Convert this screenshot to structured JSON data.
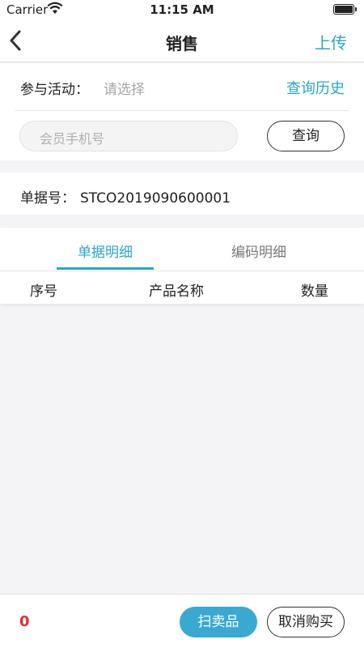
{
  "status_bar": {
    "carrier": "Carrier",
    "time": "11:15 AM"
  },
  "nav": {
    "title": "销售",
    "action": "上传"
  },
  "activity": {
    "label": "参与活动：",
    "value": "请选择",
    "history": "查询历史"
  },
  "member": {
    "placeholder": "会员手机号",
    "query": "查询"
  },
  "document": {
    "label": "单据号：",
    "number": "STCO2019090600001"
  },
  "tabs": [
    {
      "label": "单据明细",
      "active": true
    },
    {
      "label": "编码明细",
      "active": false
    }
  ],
  "columns": {
    "index": "序号",
    "name": "产品名称",
    "qty": "数量"
  },
  "footer": {
    "count": "0",
    "scan": "扫卖品",
    "cancel": "取消购买"
  },
  "colors": {
    "accent": "#2aa6c8",
    "count": "#e03030",
    "scan_button": "#3aa9d2"
  }
}
